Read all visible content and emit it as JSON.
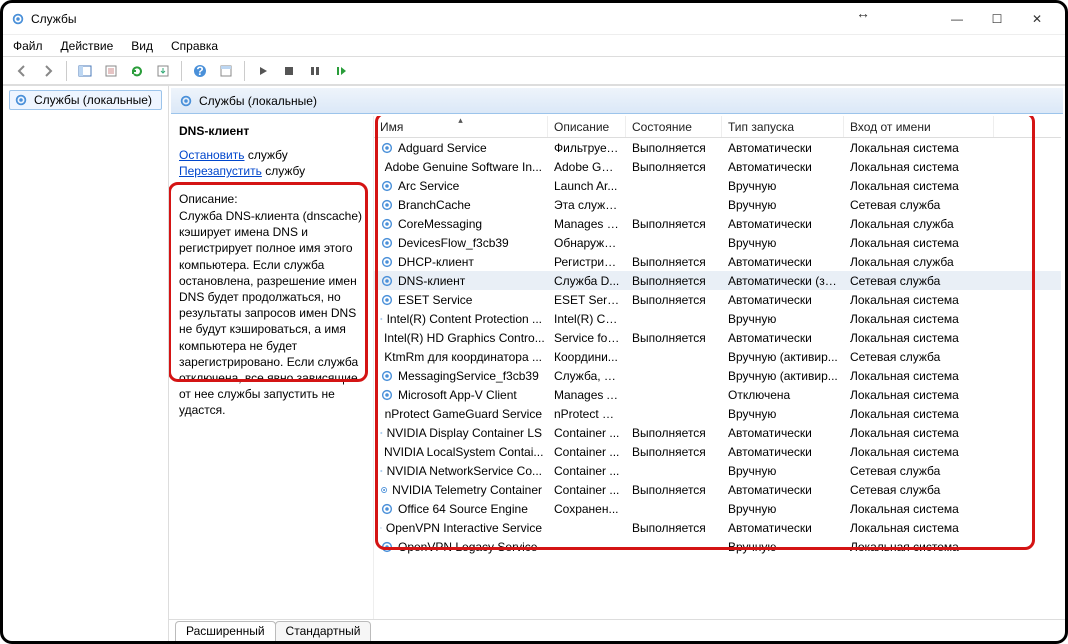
{
  "window": {
    "title": "Службы"
  },
  "menu": {
    "file": "Файл",
    "action": "Действие",
    "view": "Вид",
    "help": "Справка"
  },
  "tree": {
    "root": "Службы (локальные)"
  },
  "panelHeader": "Службы (локальные)",
  "detail": {
    "title": "DNS-клиент",
    "stopLink": "Остановить",
    "restartLink": "Перезапустить",
    "linkSuffix": "службу",
    "descLabel": "Описание:",
    "descText": "Служба DNS-клиента (dnscache) кэширует имена DNS и регистрирует полное имя этого компьютера. Если служба остановлена, разрешение имен DNS будет продолжаться, но результаты запросов имен DNS не будут кэшироваться, а имя компьютера не будет зарегистрировано. Если служба отключена, все явно зависящие от нее службы запустить не удастся."
  },
  "columns": {
    "name": "Имя",
    "desc": "Описание",
    "state": "Состояние",
    "start": "Тип запуска",
    "logon": "Вход от имени"
  },
  "tabs": {
    "extended": "Расширенный",
    "standard": "Стандартный"
  },
  "services": [
    {
      "name": "Adguard Service",
      "desc": "Фильтрует...",
      "state": "Выполняется",
      "start": "Автоматически",
      "logon": "Локальная система"
    },
    {
      "name": "Adobe Genuine Software In...",
      "desc": "Adobe Gen...",
      "state": "Выполняется",
      "start": "Автоматически",
      "logon": "Локальная система"
    },
    {
      "name": "Arc Service",
      "desc": " Launch Ar...",
      "state": "",
      "start": "Вручную",
      "logon": "Локальная система"
    },
    {
      "name": "BranchCache",
      "desc": "Эта служб...",
      "state": "",
      "start": "Вручную",
      "logon": "Сетевая служба"
    },
    {
      "name": "CoreMessaging",
      "desc": "Manages c...",
      "state": "Выполняется",
      "start": "Автоматически",
      "logon": "Локальная служба"
    },
    {
      "name": "DevicesFlow_f3cb39",
      "desc": "Обнаруже...",
      "state": "",
      "start": "Вручную",
      "logon": "Локальная система"
    },
    {
      "name": "DHCP-клиент",
      "desc": "Регистрир...",
      "state": "Выполняется",
      "start": "Автоматически",
      "logon": "Локальная служба"
    },
    {
      "name": "DNS-клиент",
      "desc": "Служба D...",
      "state": "Выполняется",
      "start": "Автоматически (за...",
      "logon": "Сетевая служба",
      "selected": true
    },
    {
      "name": "ESET Service",
      "desc": "ESET Service",
      "state": "Выполняется",
      "start": "Автоматически",
      "logon": "Локальная система"
    },
    {
      "name": "Intel(R) Content Protection ...",
      "desc": "Intel(R) Co...",
      "state": "",
      "start": "Вручную",
      "logon": "Локальная система"
    },
    {
      "name": "Intel(R) HD Graphics Contro...",
      "desc": "Service for ...",
      "state": "Выполняется",
      "start": "Автоматически",
      "logon": "Локальная система"
    },
    {
      "name": "KtmRm для координатора ...",
      "desc": "Координи...",
      "state": "",
      "start": "Вручную (активир...",
      "logon": "Сетевая служба"
    },
    {
      "name": "MessagingService_f3cb39",
      "desc": "Служба, о...",
      "state": "",
      "start": "Вручную (активир...",
      "logon": "Локальная система"
    },
    {
      "name": "Microsoft App-V Client",
      "desc": "Manages A...",
      "state": "",
      "start": "Отключена",
      "logon": "Локальная система"
    },
    {
      "name": "nProtect GameGuard Service",
      "desc": "nProtect G...",
      "state": "",
      "start": "Вручную",
      "logon": "Локальная система"
    },
    {
      "name": "NVIDIA Display Container LS",
      "desc": "Container ...",
      "state": "Выполняется",
      "start": "Автоматически",
      "logon": "Локальная система"
    },
    {
      "name": "NVIDIA LocalSystem Contai...",
      "desc": "Container ...",
      "state": "Выполняется",
      "start": "Автоматически",
      "logon": "Локальная система"
    },
    {
      "name": "NVIDIA NetworkService Co...",
      "desc": "Container ...",
      "state": "",
      "start": "Вручную",
      "logon": "Сетевая служба"
    },
    {
      "name": "NVIDIA Telemetry Container",
      "desc": "Container ...",
      "state": "Выполняется",
      "start": "Автоматически",
      "logon": "Сетевая служба"
    },
    {
      "name": "Office 64 Source Engine",
      "desc": "Сохранен...",
      "state": "",
      "start": "Вручную",
      "logon": "Локальная система"
    },
    {
      "name": "OpenVPN Interactive Service",
      "desc": "",
      "state": "Выполняется",
      "start": "Автоматически",
      "logon": "Локальная система"
    },
    {
      "name": "OpenVPN Legacy Service",
      "desc": "",
      "state": "",
      "start": "Вручную",
      "logon": "Локальная система"
    }
  ]
}
